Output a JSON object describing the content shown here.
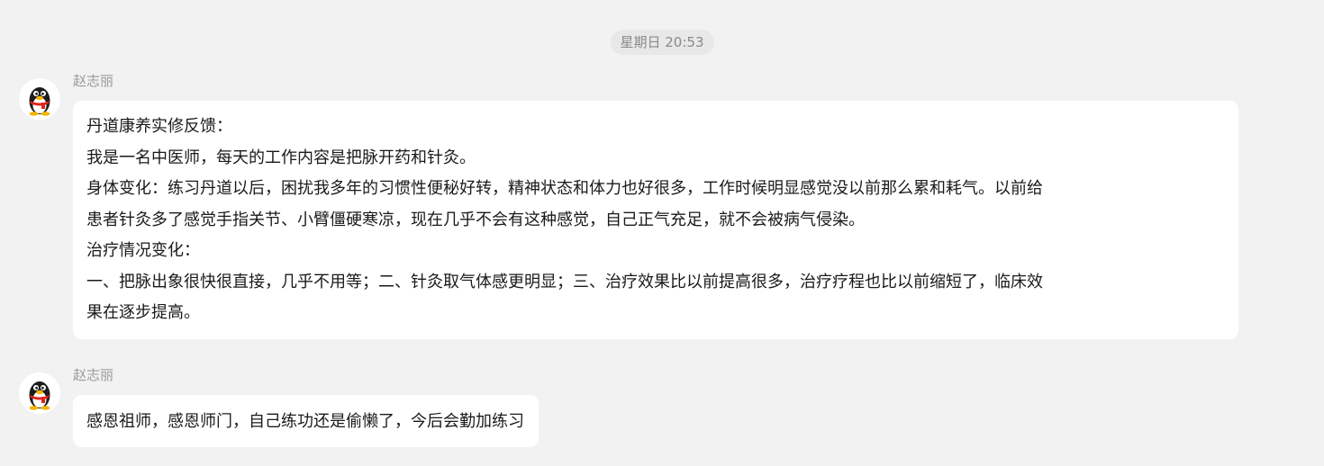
{
  "chat": {
    "timestamp": "星期日 20:53",
    "messages": [
      {
        "sender": "赵志丽",
        "avatar_icon": "qq-penguin-icon",
        "lines": [
          "丹道康养实修反馈：",
          "我是一名中医师，每天的工作内容是把脉开药和针灸。",
          "身体变化：练习丹道以后，困扰我多年的习惯性便秘好转，精神状态和体力也好很多，工作时候明显感觉没以前那么累和耗气。以前给",
          "患者针灸多了感觉手指关节、小臂僵硬寒凉，现在几乎不会有这种感觉，自己正气充足，就不会被病气侵染。",
          "治疗情况变化：",
          "一、把脉出象很快很直接，几乎不用等；二、针灸取气体感更明显；三、治疗效果比以前提高很多，治疗疗程也比以前缩短了，临床效",
          "果在逐步提高。"
        ]
      },
      {
        "sender": "赵志丽",
        "avatar_icon": "qq-penguin-icon",
        "lines": [
          "感恩祖师，感恩师门，自己练功还是偷懒了，今后会勤加练习"
        ]
      }
    ]
  },
  "colors": {
    "background": "#f2f2f2",
    "bubble": "#ffffff",
    "sender_text": "#9a9a9a",
    "timestamp_text": "#8a8a8a",
    "message_text": "#1a1a1a"
  }
}
